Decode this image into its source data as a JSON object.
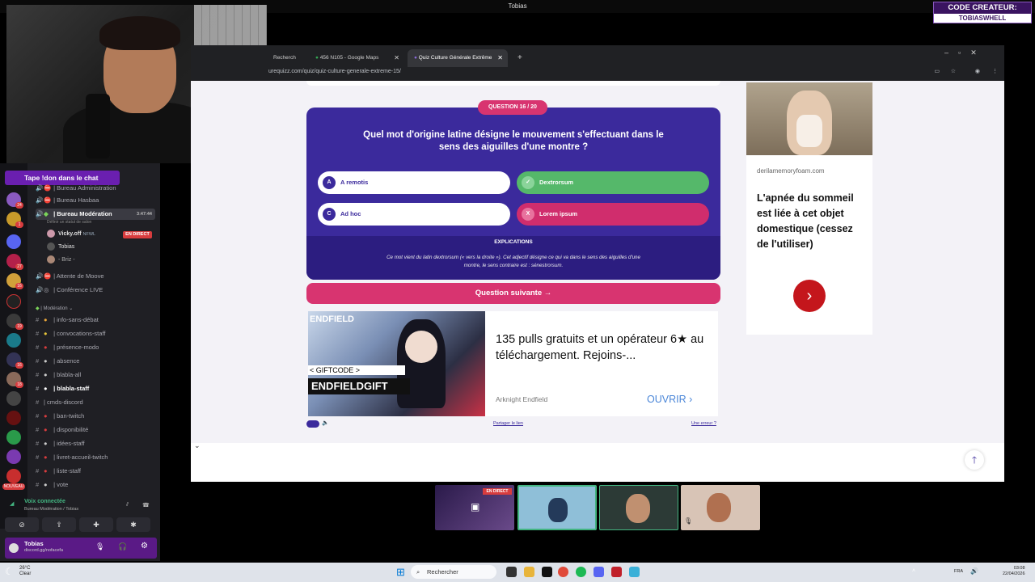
{
  "stream": {
    "window_title": "Tobias",
    "creator_code_label": "CODE CREATEUR:",
    "creator_code": "TOBIASWHELL",
    "chat_banner": "Tape !don dans le chat"
  },
  "discord": {
    "channels": [
      {
        "label": "Bureau Administration",
        "type": "voice"
      },
      {
        "label": "Bureau Hasbaa",
        "type": "voice"
      },
      {
        "label": "Bureau Modération",
        "type": "voice",
        "active": true,
        "timer": "3:47:44",
        "status": "Définir un statut de salon"
      },
      {
        "label": "Attente de Moove",
        "type": "voice"
      },
      {
        "label": "Conférence LIVE",
        "type": "voice"
      }
    ],
    "voice_users": [
      {
        "name": "Vicky.off",
        "tag": "NFWL",
        "live": "EN DIRECT"
      },
      {
        "name": "Tobias"
      },
      {
        "name": "- Briz -"
      }
    ],
    "category": "Modération",
    "text_channels": [
      "info-sans-débat",
      "convocations-staff",
      "présence-modo",
      "absence",
      "blabla-all",
      "blabla-staff",
      "cmds-discord",
      "ban-twitch",
      "disponibilité",
      "idées-staff",
      "livret-accueil-twitch",
      "liste-staff",
      "vote"
    ],
    "voice_status": "Voix connectée",
    "voice_location": "Bureau Modération / Tobias",
    "user_name": "Tobias",
    "user_status": "discord.gg/nofacefa",
    "server_badges": [
      "24",
      "1",
      "27",
      "16",
      "19",
      "16",
      "18",
      "NOUVEAU"
    ]
  },
  "browser": {
    "tabs": [
      {
        "label": "Recherch"
      },
      {
        "label": "456 N105 - Google Maps"
      },
      {
        "label": "Quiz Culture Générale Extrême",
        "active": true
      }
    ],
    "url": "urequizz.com/quiz/quiz-culture-generale-extreme-15/"
  },
  "quiz": {
    "badge": "QUESTION 16 / 20",
    "question": "Quel mot d'origine latine désigne le mouvement s'effectuant dans le sens des aiguilles d'une montre ?",
    "answers": [
      {
        "letter": "A",
        "text": "A remotis",
        "state": "neutral"
      },
      {
        "letter": "✓",
        "text": "Dextrorsum",
        "state": "correct"
      },
      {
        "letter": "C",
        "text": "Ad hoc",
        "state": "neutral"
      },
      {
        "letter": "X",
        "text": "Lorem ipsum",
        "state": "wrong"
      }
    ],
    "explanation_title": "EXPLICATIONS",
    "explanation": "Ce mot vient du latin dextrorsum (« vers la droite »). Cet adjectif désigne ce qui va dans le sens des aiguilles d'une montre, le sens contraire est : sénestrorsum.",
    "next_button": "Question suivante",
    "share_link": "Partager le lien",
    "error_link": "Une erreur ?"
  },
  "ad": {
    "logo": "ENDFIELD",
    "gift_line1": "< GIFTCODE >",
    "gift_line2": "ENDFIELDGIFT",
    "title": "135 pulls gratuits et un opérateur 6★ au téléchargement. Rejoins-...",
    "source": "Arknight Endfield",
    "cta": "OUVRIR"
  },
  "side_ad": {
    "domain": "derilamemoryfoam.com",
    "title": "L'apnée du sommeil est liée à cet objet domestique (cessez de l'utiliser)"
  },
  "thumbnails": {
    "live_label": "EN DIRECT"
  },
  "taskbar": {
    "temperature": "26°C",
    "weather": "Clear",
    "search": "Rechercher",
    "lang": "FRA",
    "time": "03:08",
    "date": "22/04/2026"
  },
  "colors": {
    "quiz_bg": "#3b2a9c",
    "accent_pink": "#d83470",
    "correct": "#55b86a",
    "wrong": "#d02d6d"
  }
}
